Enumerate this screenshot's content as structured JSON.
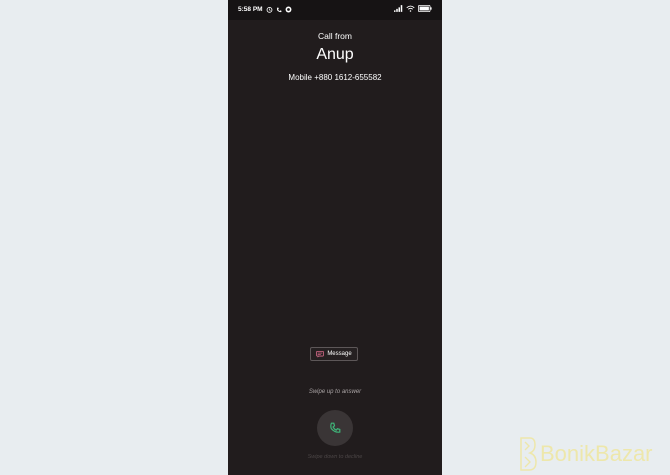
{
  "status_bar": {
    "time": "5:58 PM",
    "left_icons": [
      "alarm-icon",
      "phone-icon",
      "whatsapp-icon"
    ],
    "right_icons": [
      "signal-icon",
      "wifi-icon",
      "battery-icon"
    ],
    "battery_level": "100"
  },
  "call": {
    "call_from_label": "Call from",
    "caller_name": "Anup",
    "caller_number": "Mobile +880 1612-655582"
  },
  "actions": {
    "message_label": "Message",
    "swipe_up_hint": "Swipe up to answer",
    "swipe_down_hint": "Swipe down to decline"
  },
  "colors": {
    "screen_bg": "#211c1d",
    "answer_icon": "#3fb67a",
    "message_icon": "#d86b8a"
  },
  "watermark": {
    "text": "BonikBazar"
  }
}
